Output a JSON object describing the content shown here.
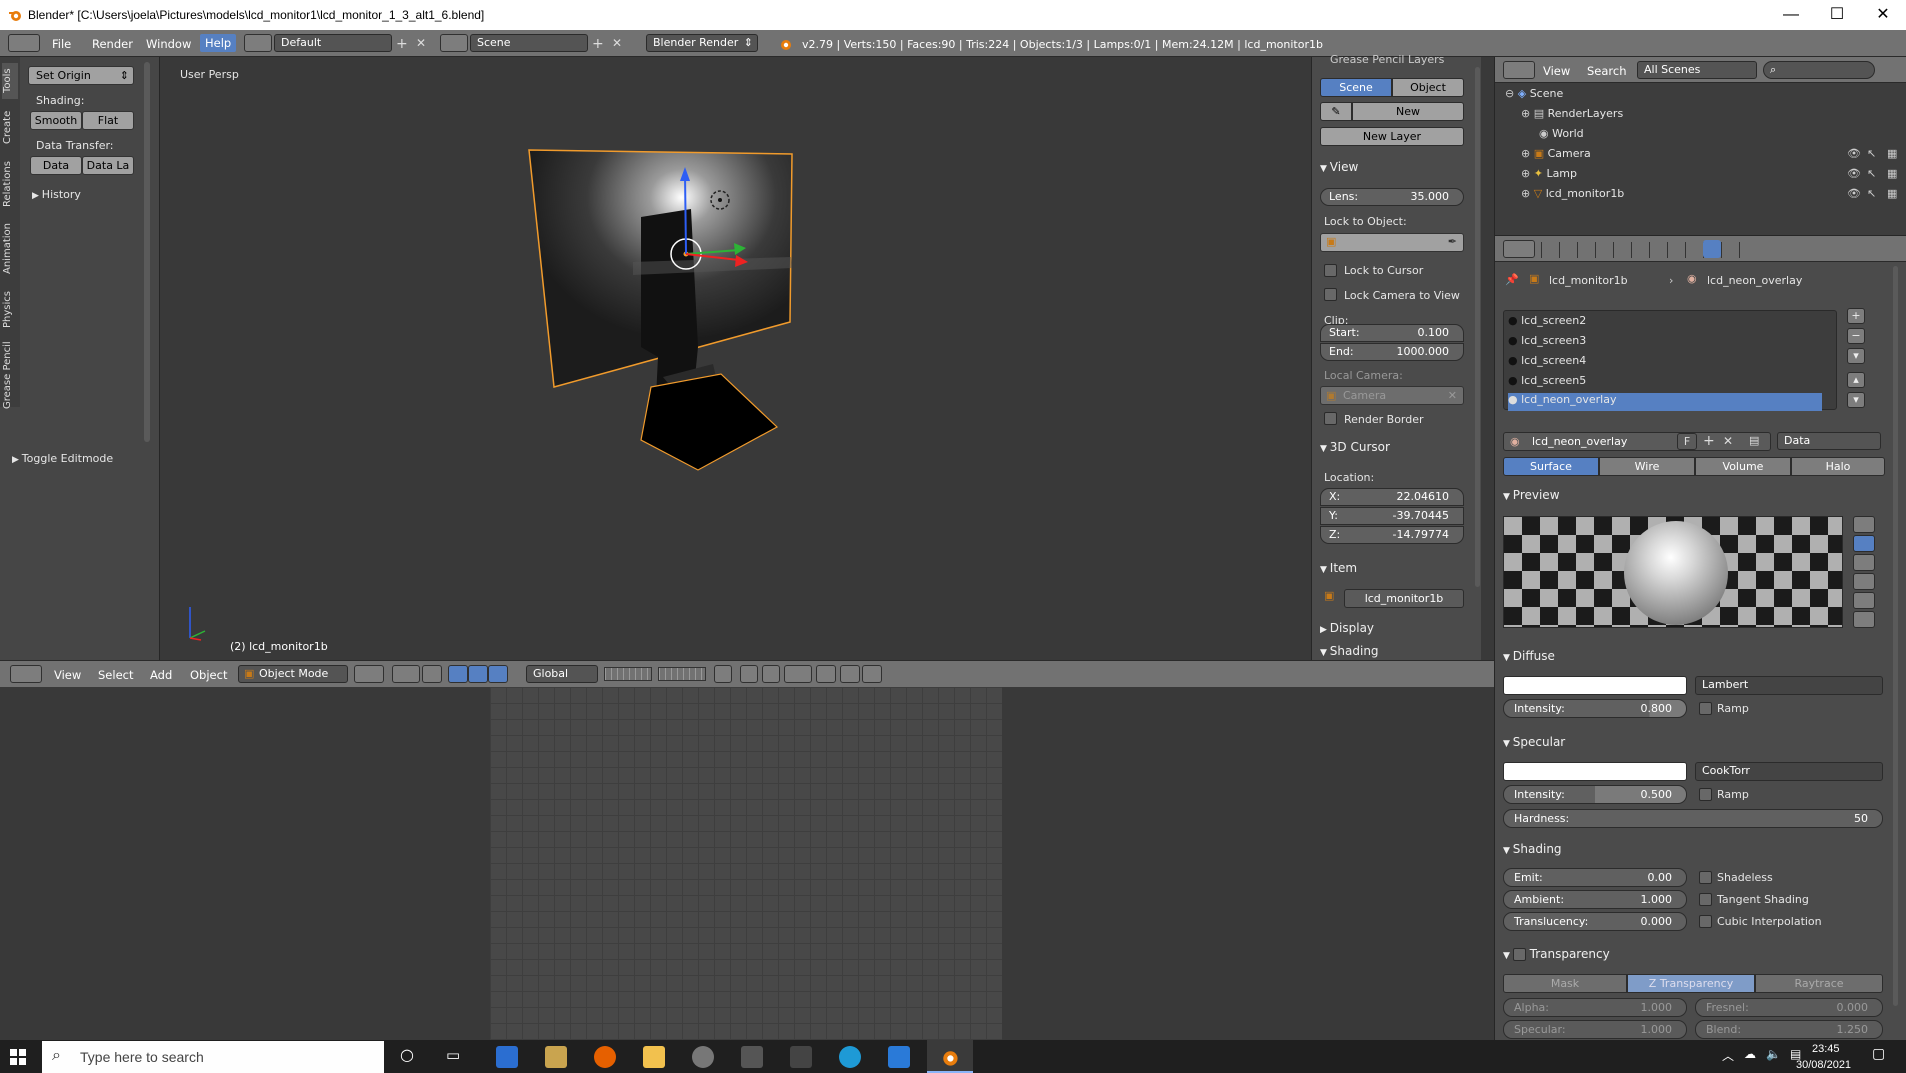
{
  "titlebar": {
    "title": "Blender* [C:\\Users\\joela\\Pictures\\models\\lcd_monitor1\\lcd_monitor_1_3_alt1_6.blend]",
    "minimize": "—",
    "maximize": "☐",
    "close": "✕"
  },
  "menu": {
    "file": "File",
    "render": "Render",
    "window": "Window",
    "help": "Help"
  },
  "screen_layout": "Default",
  "scene_name": "Scene",
  "render_engine": "Blender Render",
  "stats": "v2.79 | Verts:150 | Faces:90 | Tris:224 | Objects:1/3 | Lamps:0/1 | Mem:24.12M | lcd_monitor1b",
  "toolshelf": {
    "tabs": [
      "Tools",
      "Create",
      "Relations",
      "Animation",
      "Physics",
      "Grease Pencil"
    ],
    "set_origin": "Set Origin",
    "shading_label": "Shading:",
    "smooth": "Smooth",
    "flat": "Flat",
    "data_transfer_label": "Data Transfer:",
    "data": "Data",
    "data_la": "Data La",
    "history": "History",
    "toggle_editmode": "Toggle Editmode"
  },
  "viewport": {
    "view_name": "User Persp",
    "object_label": "(2) lcd_monitor1b"
  },
  "npanel": {
    "grease_title": "Grease Pencil Layers",
    "scene_tab": "Scene",
    "object_tab": "Object",
    "new": "New",
    "new_layer": "New Layer",
    "view_head": "View",
    "lens_label": "Lens:",
    "lens_value": "35.000",
    "lock_to_object": "Lock to Object:",
    "lock_to_cursor": "Lock to Cursor",
    "lock_camera": "Lock Camera to View",
    "clip": "Clip:",
    "start_label": "Start:",
    "start_value": "0.100",
    "end_label": "End:",
    "end_value": "1000.000",
    "local_camera": "Local Camera:",
    "camera": "Camera",
    "render_border": "Render Border",
    "cursor_head": "3D Cursor",
    "location": "Location:",
    "x_label": "X:",
    "x_value": "22.04610",
    "y_label": "Y:",
    "y_value": "-39.70445",
    "z_label": "Z:",
    "z_value": "-14.79774",
    "item_head": "Item",
    "item_name": "lcd_monitor1b",
    "display_head": "Display",
    "shading_head": "Shading"
  },
  "v3dheader": {
    "view": "View",
    "select": "Select",
    "add": "Add",
    "object": "Object",
    "mode": "Object Mode",
    "orientation": "Global"
  },
  "outliner": {
    "view": "View",
    "search": "Search",
    "filter": "All Scenes",
    "items": [
      "Scene",
      "RenderLayers",
      "World",
      "Camera",
      "Lamp",
      "lcd_monitor1b"
    ]
  },
  "properties": {
    "breadcrumb_object": "lcd_monitor1b",
    "breadcrumb_material": "lcd_neon_overlay",
    "slots": [
      "lcd_screen2",
      "lcd_screen3",
      "lcd_screen4",
      "lcd_screen5",
      "lcd_neon_overlay"
    ],
    "material_name": "lcd_neon_overlay",
    "f_btn": "F",
    "link": "Data",
    "tabs": [
      "Surface",
      "Wire",
      "Volume",
      "Halo"
    ],
    "preview_head": "Preview",
    "diffuse_head": "Diffuse",
    "diffuse_shader": "Lambert",
    "intensity_label": "Intensity:",
    "diffuse_intensity": "0.800",
    "ramp": "Ramp",
    "specular_head": "Specular",
    "specular_shader": "CookTorr",
    "specular_intensity": "0.500",
    "hardness_label": "Hardness:",
    "hardness": "50",
    "shading_head": "Shading",
    "emit_label": "Emit:",
    "emit": "0.00",
    "shadeless": "Shadeless",
    "ambient_label": "Ambient:",
    "ambient": "1.000",
    "tangent": "Tangent Shading",
    "translucency_label": "Translucency:",
    "translucency": "0.000",
    "cubic": "Cubic Interpolation",
    "transparency_head": "Transparency",
    "trans_tabs": [
      "Mask",
      "Z Transparency",
      "Raytrace"
    ],
    "alpha_label": "Alpha:",
    "alpha": "1.000",
    "fresnel_label": "Fresnel:",
    "fresnel": "0.000",
    "specular_label": "Specular:",
    "specular_val": "1.000",
    "blend_label": "Blend:",
    "blend": "1.250"
  },
  "taskbar": {
    "search_placeholder": "Type here to search",
    "time": "23:45",
    "date": "30/08/2021"
  },
  "colors": {
    "accent": "#5680c2",
    "selected_outline": "#f19b2c",
    "taskbar": "#1f1f1f"
  }
}
